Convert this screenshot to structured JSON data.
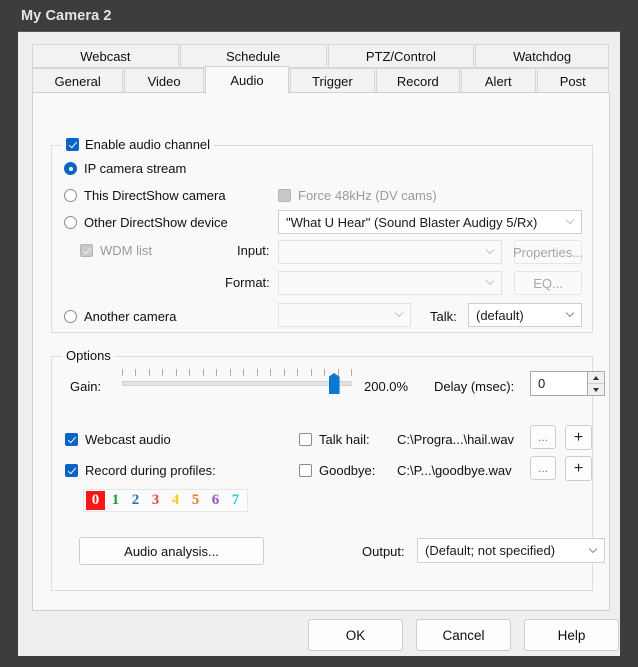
{
  "window": {
    "title": "My Camera 2"
  },
  "tabs": {
    "row1": [
      {
        "label": "Webcast",
        "active": false
      },
      {
        "label": "Schedule",
        "active": false
      },
      {
        "label": "PTZ/Control",
        "active": false
      },
      {
        "label": "Watchdog",
        "active": false
      }
    ],
    "row2": [
      {
        "label": "General",
        "active": false
      },
      {
        "label": "Video",
        "active": false
      },
      {
        "label": "Audio",
        "active": true
      },
      {
        "label": "Trigger",
        "active": false
      },
      {
        "label": "Record",
        "active": false
      },
      {
        "label": "Alert",
        "active": false
      },
      {
        "label": "Post",
        "active": false
      }
    ]
  },
  "audio_group": {
    "legend": "Enable audio channel",
    "legend_checked": true,
    "sources": [
      {
        "label": "IP camera stream",
        "selected": true
      },
      {
        "label": "This DirectShow camera",
        "selected": false
      },
      {
        "label": "Other DirectShow device",
        "selected": false
      },
      {
        "label": "Another camera",
        "selected": false
      }
    ],
    "force48": {
      "label": "Force 48kHz (DV cams)",
      "checked": false,
      "disabled": true
    },
    "device_combo": {
      "value": "\"What U Hear\" (Sound Blaster Audigy 5/Rx)"
    },
    "wdm": {
      "label": "WDM list",
      "checked": true,
      "disabled": true
    },
    "input_label": "Input:",
    "input_combo": {
      "value": ""
    },
    "format_label": "Format:",
    "format_combo": {
      "value": ""
    },
    "properties_button": "Properties...",
    "eq_button": "EQ...",
    "another_combo": {
      "value": ""
    },
    "talk_label": "Talk:",
    "talk_combo": {
      "value": "(default)"
    }
  },
  "options_group": {
    "legend": "Options",
    "gain_label": "Gain:",
    "gain_value": "200.0%",
    "gain_percent": 92,
    "tick_count": 18,
    "delay_label": "Delay (msec):",
    "delay_value": "0",
    "webcast_audio": {
      "label": "Webcast audio",
      "checked": true
    },
    "record_during_profiles": {
      "label": "Record during profiles:",
      "checked": true
    },
    "talk_hail": {
      "label": "Talk hail:",
      "checked": false,
      "path": "C:\\Progra...\\hail.wav"
    },
    "goodbye": {
      "label": "Goodbye:",
      "checked": false,
      "path": "C:\\P...\\goodbye.wav"
    },
    "browse_button": "...",
    "add_button": "+",
    "profiles": [
      {
        "label": "0",
        "color": "#ffffff",
        "background": "#fb1616",
        "selected": true
      },
      {
        "label": "1",
        "color": "#14a32c",
        "background": "transparent",
        "selected": false
      },
      {
        "label": "2",
        "color": "#2e72bd",
        "background": "transparent",
        "selected": false
      },
      {
        "label": "3",
        "color": "#e8464f",
        "background": "transparent",
        "selected": false
      },
      {
        "label": "4",
        "color": "#f2d020",
        "background": "transparent",
        "selected": false
      },
      {
        "label": "5",
        "color": "#f07d1e",
        "background": "transparent",
        "selected": false
      },
      {
        "label": "6",
        "color": "#9a4fd0",
        "background": "transparent",
        "selected": false
      },
      {
        "label": "7",
        "color": "#2ecfd6",
        "background": "transparent",
        "selected": false
      }
    ],
    "audio_analysis_button": "Audio analysis...",
    "output_label": "Output:",
    "output_combo": {
      "value": "(Default; not specified)"
    }
  },
  "footer": {
    "ok": "OK",
    "cancel": "Cancel",
    "help": "Help"
  }
}
